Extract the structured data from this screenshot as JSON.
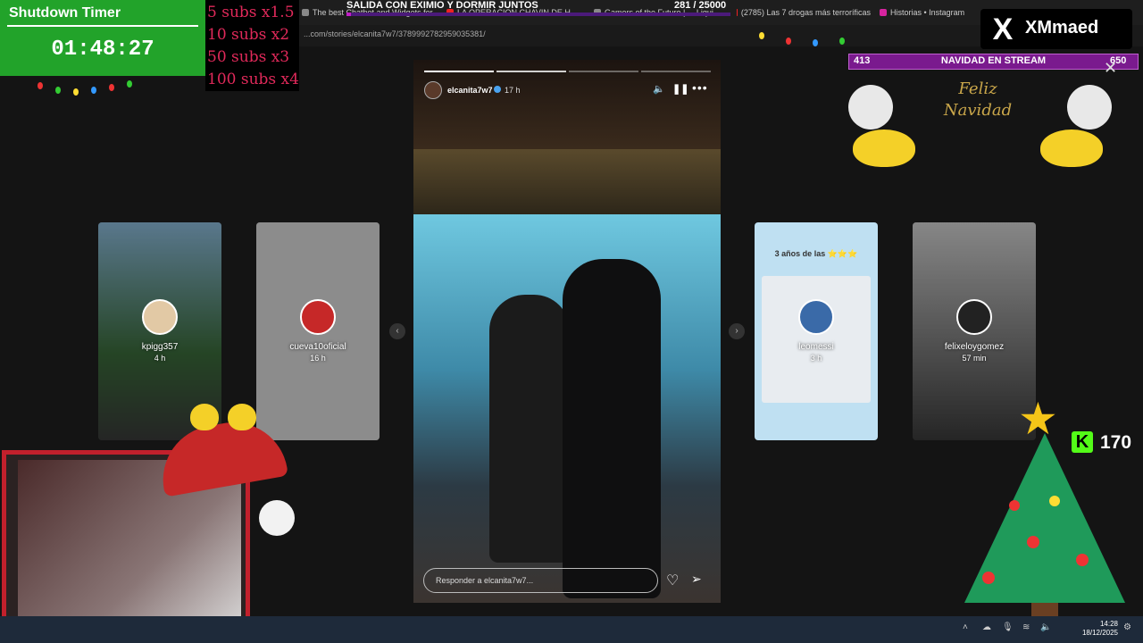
{
  "browser": {
    "tabs": [
      {
        "label": "The best Chatbot and Widgets for...",
        "favicon": "site-icon"
      },
      {
        "label": "CON EXIMIO Y DORMIR JUNTOS",
        "favicon": "site-icon"
      },
      {
        "label": "LA OPERACION CHAVIN DE H...",
        "favicon": "youtube-icon"
      },
      {
        "label": "Gamers of the Future | ... Liqui...",
        "favicon": "site-icon"
      },
      {
        "label": "(2785) Las 7 drogas más terroríficas",
        "favicon": "youtube-icon"
      },
      {
        "label": "Historias • Instagram",
        "favicon": "instagram-icon"
      }
    ],
    "url": "...com/stories/elcanita7w7/3789992782959035381/"
  },
  "overlay": {
    "timer_title": "Shutdown Timer",
    "timer_value": "01:48:27",
    "subs_rules": [
      "5 subs x1.5",
      "10 subs x2",
      "50 subs x3",
      "100 subs x4"
    ],
    "stream_title": "SALIDA CON EXIMIO Y DORMIR JUNTOS",
    "goal": "281 / 25000",
    "goal_progress_fraction": 0.0112,
    "x_handle": "XMmaed",
    "x_logo": "X",
    "navidad_left": "413",
    "navidad_title": "NAVIDAD EN STREAM",
    "navidad_right": "650",
    "feliz_navidad": "Feliz Navidad",
    "kick_icon": "K",
    "kick_count": "170"
  },
  "stories": {
    "side": [
      {
        "user": "kpigg357",
        "time": "4 h"
      },
      {
        "user": "cueva10oficial",
        "time": "16 h"
      },
      {
        "user": "leomessi",
        "time": "3 h",
        "header": "3 años de las ⭐⭐⭐"
      },
      {
        "user": "felixeloygomez",
        "time": "57 min"
      }
    ],
    "main": {
      "user": "elcanita7w7",
      "time": "17 h",
      "reply_placeholder": "Responder a elcanita7w7...",
      "segments": 4,
      "active_segment": 2
    },
    "nav_prev": "‹",
    "nav_next": "›"
  },
  "taskbar": {
    "time": "14:28",
    "date": "18/12/2025"
  },
  "colors": {
    "timer_bg": "#22a32a",
    "subs_text": "#e0295a",
    "banner": "#7a1a8e",
    "kick": "#53fc18"
  }
}
